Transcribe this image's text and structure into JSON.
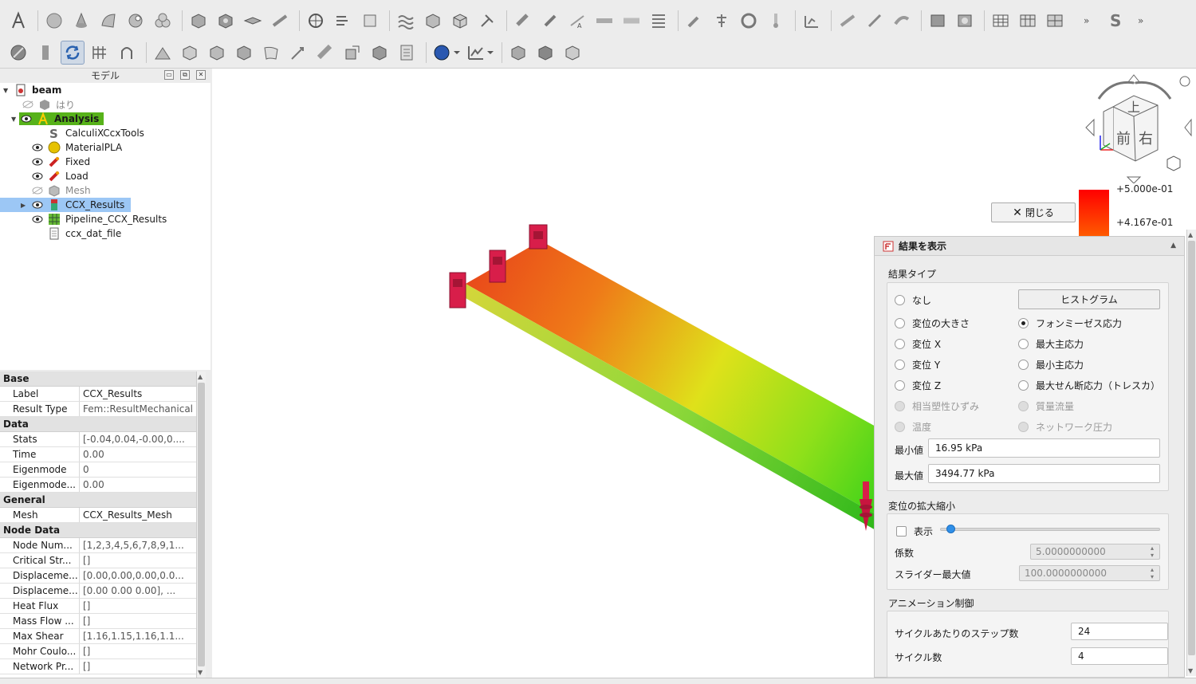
{
  "model_panel": {
    "title": "モデル",
    "tree": [
      {
        "label": "beam",
        "bold": true
      },
      {
        "label": "はり"
      },
      {
        "label": "Analysis"
      },
      {
        "label": "CalculiXCcxTools"
      },
      {
        "label": "MaterialPLA"
      },
      {
        "label": "Fixed"
      },
      {
        "label": "Load"
      },
      {
        "label": "Mesh"
      },
      {
        "label": "CCX_Results"
      },
      {
        "label": "Pipeline_CCX_Results"
      },
      {
        "label": "ccx_dat_file"
      }
    ]
  },
  "properties": {
    "groups": [
      {
        "name": "Base",
        "rows": [
          {
            "key": "Label",
            "value": "CCX_Results"
          },
          {
            "key": "Result Type",
            "value": "Fem::ResultMechanical"
          }
        ]
      },
      {
        "name": "Data",
        "rows": [
          {
            "key": "Stats",
            "value": "[-0.04,0.04,-0.00,0...."
          },
          {
            "key": "Time",
            "value": "0.00"
          },
          {
            "key": "Eigenmode",
            "value": "0"
          },
          {
            "key": "Eigenmode...",
            "value": "0.00"
          }
        ]
      },
      {
        "name": "General",
        "rows": [
          {
            "key": "Mesh",
            "value": "CCX_Results_Mesh"
          }
        ]
      },
      {
        "name": "Node Data",
        "rows": [
          {
            "key": "Node Num...",
            "value": "[1,2,3,4,5,6,7,8,9,1..."
          },
          {
            "key": "Critical Str...",
            "value": "[]"
          },
          {
            "key": "Displaceme...",
            "value": "[0.00,0.00,0.00,0.0..."
          },
          {
            "key": "Displaceme...",
            "value": "[0.00 0.00 0.00], ..."
          },
          {
            "key": "Heat Flux",
            "value": "[]"
          },
          {
            "key": "Mass Flow ...",
            "value": "[]"
          },
          {
            "key": "Max Shear",
            "value": "[1.16,1.15,1.16,1.1..."
          },
          {
            "key": "Mohr Coulo...",
            "value": "[]"
          },
          {
            "key": "Network Pr...",
            "value": "[]"
          }
        ]
      }
    ]
  },
  "navcube": {
    "top": "上",
    "front": "前",
    "right": "右"
  },
  "legend": {
    "max_label": "+5.000e-01",
    "second_label": "+4.167e-01"
  },
  "close_button": "閉じる",
  "task_panel": {
    "title": "結果を表示",
    "result_type_group": "結果タイプ",
    "histogram_button": "ヒストグラム",
    "radios_left": [
      "なし",
      "変位の大きさ",
      "変位 X",
      "変位 Y",
      "変位 Z",
      "相当塑性ひずみ",
      "温度"
    ],
    "radios_right": [
      "フォンミーゼス応力",
      "最大主応力",
      "最小主応力",
      "最大せん断応力（トレスカ）",
      "質量流量",
      "ネットワーク圧力"
    ],
    "min_label": "最小値",
    "min_value": "16.95 kPa",
    "max_label": "最大値",
    "max_value": "3494.77 kPa",
    "disp_group": "変位の拡大縮小",
    "show_label": "表示",
    "factor_label": "係数",
    "factor_value": "5.0000000000",
    "slider_max_label": "スライダー最大値",
    "slider_max_value": "100.0000000000",
    "slider_level": 0.05,
    "anim_group": "アニメーション制御",
    "steps_label": "サイクルあたりのステップ数",
    "steps_value": "24",
    "cycles_label": "サイクル数",
    "cycles_value": "4"
  }
}
